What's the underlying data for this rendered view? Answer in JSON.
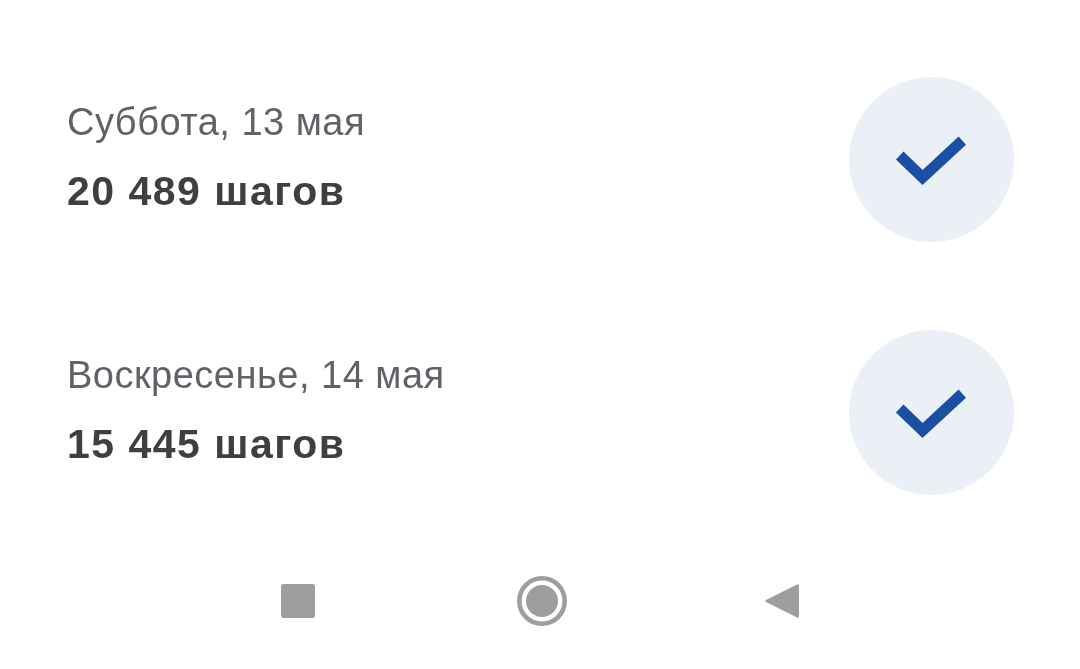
{
  "days": [
    {
      "date": "Суббота, 13 мая",
      "steps": "20 489 шагов",
      "goal_met": true
    },
    {
      "date": "Воскресенье, 14 мая",
      "steps": "15 445 шагов",
      "goal_met": true
    }
  ],
  "nav_bar": {
    "buttons": [
      {
        "kind": "recents"
      },
      {
        "kind": "home"
      },
      {
        "kind": "back"
      }
    ]
  }
}
